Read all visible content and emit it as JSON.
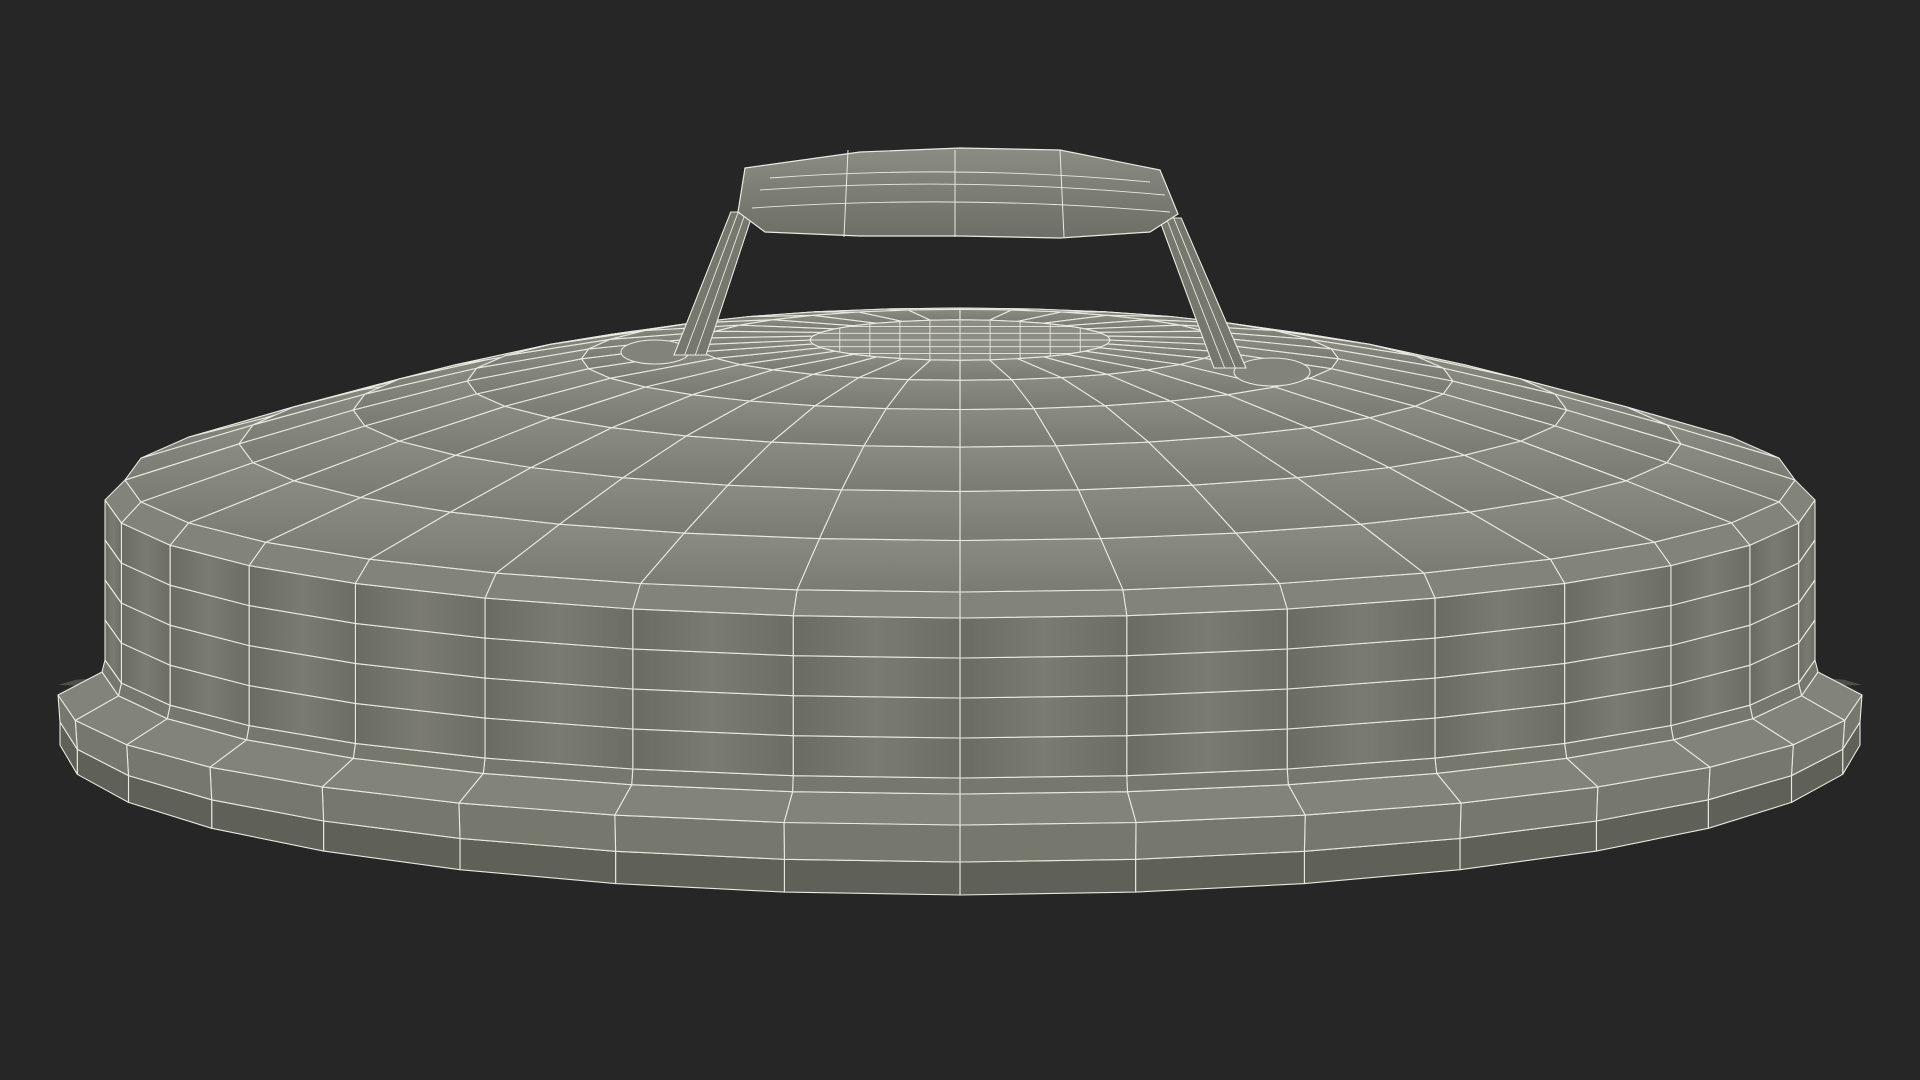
{
  "scene": {
    "subject": "wireframe-pan-lid",
    "colors": {
      "background": "#262626",
      "surface_light": "#82837a",
      "surface_mid": "#76776d",
      "surface_dark": "#5f6058",
      "rim_shadow": "#4e4f48",
      "wire": "#e9e9df"
    },
    "mesh": {
      "radial_segments": 32,
      "dome_rings": 6,
      "wall_bands": 4,
      "rim_bands": 3
    }
  }
}
